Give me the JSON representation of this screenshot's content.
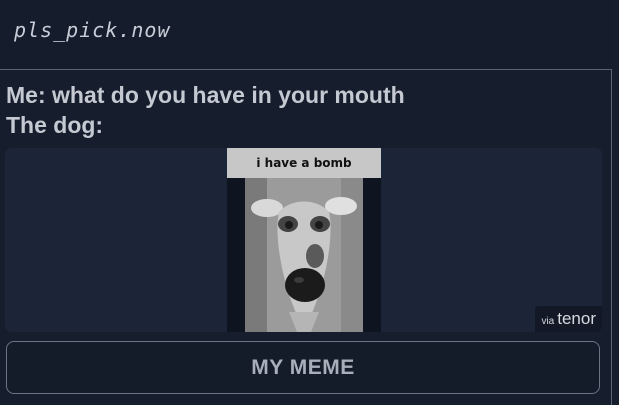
{
  "header": {
    "username": "pls_pick.now"
  },
  "post": {
    "caption_line1": "Me: what do you have in your mouth",
    "caption_line2": "The dog:"
  },
  "gif": {
    "banner_text": "i have a bomb",
    "attribution_via": "via",
    "attribution_brand": "tenor"
  },
  "actions": {
    "my_meme_label": "MY MEME"
  }
}
